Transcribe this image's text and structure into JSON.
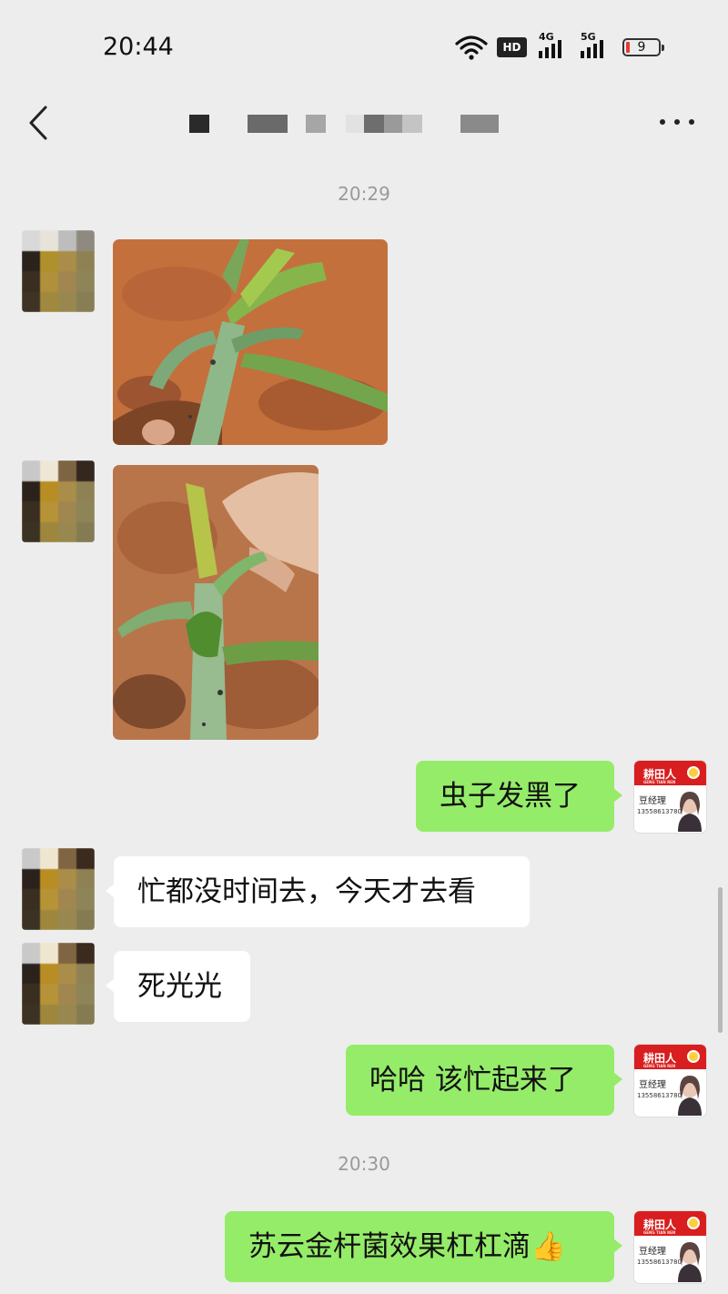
{
  "status_bar": {
    "time": "20:44",
    "hd_label": "HD",
    "network_1": "4G",
    "network_2": "5G",
    "battery_level": "9"
  },
  "nav": {
    "back_icon": "chevron-left-icon",
    "more_icon": "more-horizontal-icon"
  },
  "messages": [
    {
      "type": "timestamp",
      "text": "20:29"
    },
    {
      "type": "image",
      "side": "left",
      "content": "corn seedling with damaged leaves on red soil"
    },
    {
      "type": "image",
      "side": "left",
      "content": "hand holding damaged corn seedling"
    },
    {
      "type": "text",
      "side": "right",
      "text": "虫子发黑了"
    },
    {
      "type": "text",
      "side": "left",
      "text": "忙都没时间去，今天才去看"
    },
    {
      "type": "text",
      "side": "left",
      "text": "死光光"
    },
    {
      "type": "text",
      "side": "right",
      "text": "哈哈 该忙起来了"
    },
    {
      "type": "timestamp",
      "text": "20:30"
    },
    {
      "type": "text",
      "side": "right",
      "text": "苏云金杆菌效果杠杠滴",
      "emoji": "👍"
    }
  ],
  "my_avatar": {
    "brand": "耕田人",
    "brand_sub": "GENG TIAN REN",
    "name": "豆经理",
    "phone": "13558613780"
  },
  "colors": {
    "background": "#ededed",
    "bubble_self": "#95ec69",
    "bubble_other": "#ffffff",
    "brand_red": "#d81e1e"
  }
}
